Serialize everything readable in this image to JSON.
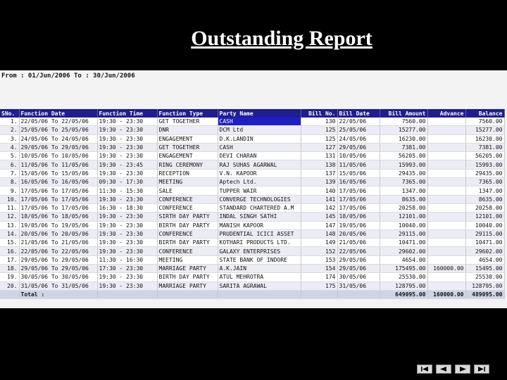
{
  "title": "Outstanding Report",
  "date_range": "From : 01/Jun/2006 To : 30/Jun/2006",
  "columns": [
    "SNo.",
    "Function Date",
    "Function Time",
    "Function Type",
    "Party Name",
    "Bill No.",
    "Bill Date",
    "Bill Amount",
    "Advance",
    "Balance"
  ],
  "rows": [
    [
      "1.",
      "22/05/06 To 22/05/06",
      "19:30 - 23:30",
      "GET TOGETHER",
      "CASH",
      "130",
      "22/05/06",
      "7560.00",
      "",
      "7560.00"
    ],
    [
      "2.",
      "25/05/06 To 25/05/06",
      "19:30 - 23:30",
      "DNR",
      "DCM Ltd",
      "125",
      "25/05/06",
      "15277.00",
      "",
      "15277.00"
    ],
    [
      "3.",
      "24/05/06 To 24/05/06",
      "19:30 - 23:30",
      "ENGAGEMENT",
      "D.K.LANDIN",
      "125",
      "24/05/06",
      "16230.00",
      "",
      "16230.00"
    ],
    [
      "4.",
      "29/05/06 To 29/05/06",
      "19:30 - 23:30",
      "GET TOGETHER",
      "CASH",
      "127",
      "29/05/06",
      "7381.00",
      "",
      "7381.00"
    ],
    [
      "5.",
      "10/05/06 To 10/05/06",
      "19:30 - 23:30",
      "ENGAGEMENT",
      "DEVI CHARAN",
      "131",
      "10/05/06",
      "56205.00",
      "",
      "56205.00"
    ],
    [
      "6.",
      "11/05/06 To 11/05/06",
      "19:30 - 23:45",
      "RING CEREMONY",
      "RAJ SUHAS AGARWAL",
      "138",
      "11/05/06",
      "15993.00",
      "",
      "15993.00"
    ],
    [
      "7.",
      "15/05/06 To 15/05/06",
      "19:30 - 23:30",
      "RECEPTION",
      "V.N. KAPOOR",
      "137",
      "15/05/06",
      "29435.00",
      "",
      "29435.00"
    ],
    [
      "8.",
      "16/05/06 To 16/05/06",
      "09:30 - 17:30",
      "MEETING",
      "Aptech Ltd.",
      "139",
      "16/05/06",
      "7365.00",
      "",
      "7365.00"
    ],
    [
      "9.",
      "17/05/06 To 17/05/06",
      "11:30 - 15:30",
      "SALE",
      "TUPPER WAIR",
      "140",
      "17/05/06",
      "1347.00",
      "",
      "1347.00"
    ],
    [
      "10.",
      "17/05/06 To 17/05/06",
      "19:30 - 23:30",
      "CONFERENCE",
      "CONVERGE TECHNOLOGIES",
      "141",
      "17/05/06",
      "8635.00",
      "",
      "8635.00"
    ],
    [
      "11.",
      "17/05/06 To 17/05/06",
      "16:30 - 18:30",
      "CONFERENCE",
      "STANDARD CHARTERED A.M",
      "142",
      "17/05/06",
      "20258.00",
      "",
      "20258.00"
    ],
    [
      "12.",
      "18/05/06 To 18/05/06",
      "19:30 - 23:30",
      "SIRTH DAY PARTY",
      "INDAL SINGH SATHI",
      "145",
      "18/05/06",
      "12101.00",
      "",
      "12101.00"
    ],
    [
      "13.",
      "19/05/06 To 19/05/06",
      "19:30 - 23:30",
      "BIRTH DAY PARTY",
      "MANISH KAPOOR",
      "147",
      "19/05/06",
      "10040.00",
      "",
      "10040.00"
    ],
    [
      "14.",
      "20/05/06 To 20/05/06",
      "19:30 - 23:30",
      "CONFERENCE",
      "PRUDENTIAL ICICI ASSET",
      "148",
      "20/05/06",
      "29115.00",
      "",
      "29115.00"
    ],
    [
      "15.",
      "21/05/06 To 21/05/06",
      "19:30 - 23:30",
      "BIRTH DAY PARTY",
      "KOTHARI PRODUCTS LTD.",
      "149",
      "21/05/06",
      "10471.00",
      "",
      "10471.00"
    ],
    [
      "16.",
      "22/05/06 To 22/05/06",
      "19:30 - 23:30",
      "CONFERENCE",
      "GALAXY ENTERPRISES",
      "152",
      "22/05/06",
      "29602.00",
      "",
      "29602.00"
    ],
    [
      "17.",
      "29/05/06 To 29/05/06",
      "11:30 - 16:30",
      "MEETING",
      "STATE BANK OF INDORE",
      "153",
      "29/05/06",
      "4654.00",
      "",
      "4654.00"
    ],
    [
      "18.",
      "29/05/06 To 29/05/06",
      "17:30 - 23:30",
      "MARRIAGE PARTY",
      "A.K.JAIN",
      "154",
      "29/05/06",
      "175495.00",
      "160000.00",
      "15495.00"
    ],
    [
      "19.",
      "30/05/06 To 30/05/06",
      "19:30 - 23:30",
      "BIRTH DAY PARTY",
      "ATUL MEHROTRA",
      "174",
      "30/05/06",
      "25530.00",
      "",
      "25530.00"
    ],
    [
      "20.",
      "31/05/06 To 31/05/06",
      "19:30 - 23:30",
      "MARRIAGE PARTY",
      "SARITA AGRAWAL",
      "175",
      "31/05/06",
      "128795.00",
      "",
      "128795.00"
    ]
  ],
  "total": {
    "label": "Total :",
    "bill_amount": "649095.00",
    "advance": "160000.00",
    "balance": "489095.00"
  },
  "nav": [
    "first-icon",
    "prev-icon",
    "next-icon",
    "last-icon"
  ]
}
